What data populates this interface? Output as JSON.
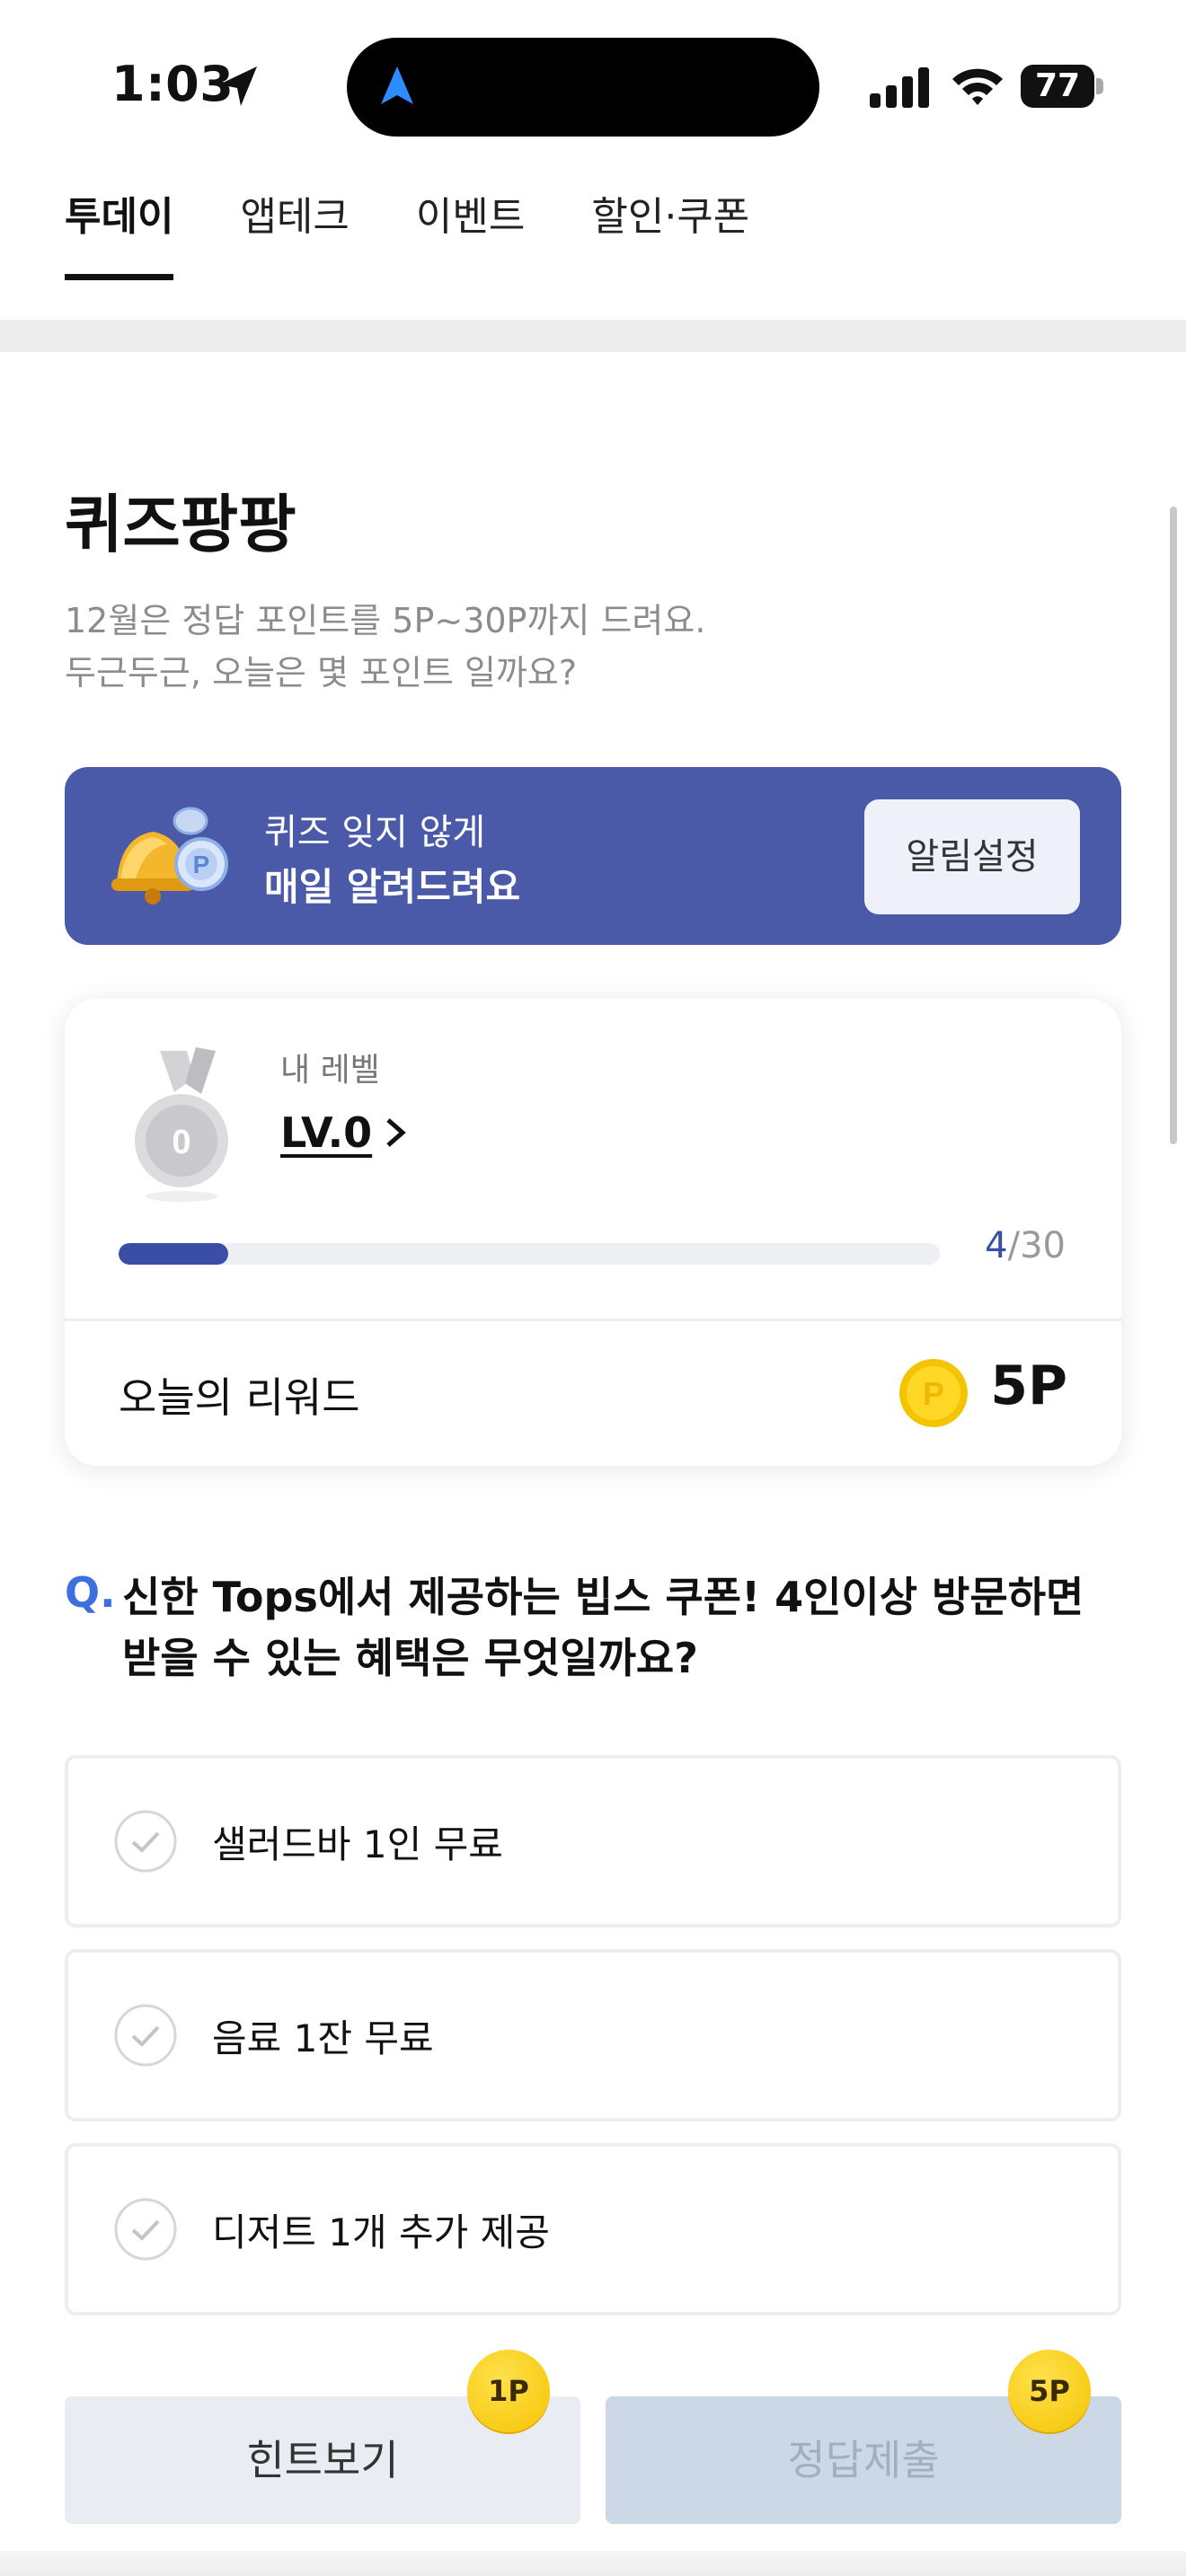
{
  "status_bar": {
    "time": "1:03",
    "battery": "77"
  },
  "tabs": [
    {
      "label": "투데이",
      "active": true
    },
    {
      "label": "앱테크",
      "active": false
    },
    {
      "label": "이벤트",
      "active": false
    },
    {
      "label": "할인·쿠폰",
      "active": false
    }
  ],
  "quiz": {
    "title": "퀴즈팡팡",
    "desc_line1": "12월은 정답 포인트를 5P~30P까지 드려요.",
    "desc_line2": "두근두근, 오늘은 몇 포인트 일까요?"
  },
  "banner": {
    "line1": "퀴즈 잊지 않게",
    "line2": "매일 알려드려요",
    "button": "알림설정"
  },
  "level_card": {
    "label": "내 레벨",
    "level": "LV.0",
    "medal_number": "0",
    "progress_current": "4",
    "progress_total": "/30",
    "progress_fraction": 0.1333,
    "reward_label": "오늘의 리워드",
    "reward_value": "5P",
    "coin_symbol": "P"
  },
  "question": {
    "mark": "Q.",
    "line1": "신한 Tops에서 제공하는 빕스 쿠폰! 4인이상 방문하면",
    "line2": "받을 수 있는 혜택은 무엇일까요?"
  },
  "options": [
    {
      "label": "샐러드바 1인 무료"
    },
    {
      "label": "음료 1잔 무료"
    },
    {
      "label": "디저트 1개 추가 제공"
    }
  ],
  "buttons": {
    "hint": "힌트보기",
    "hint_badge": "1P",
    "submit": "정답제출",
    "submit_badge": "5P"
  },
  "colors": {
    "accent": "#3a4ea8",
    "banner": "#4a5aa8",
    "question_mark": "#3d6fe0",
    "coin": "#f5c400"
  }
}
